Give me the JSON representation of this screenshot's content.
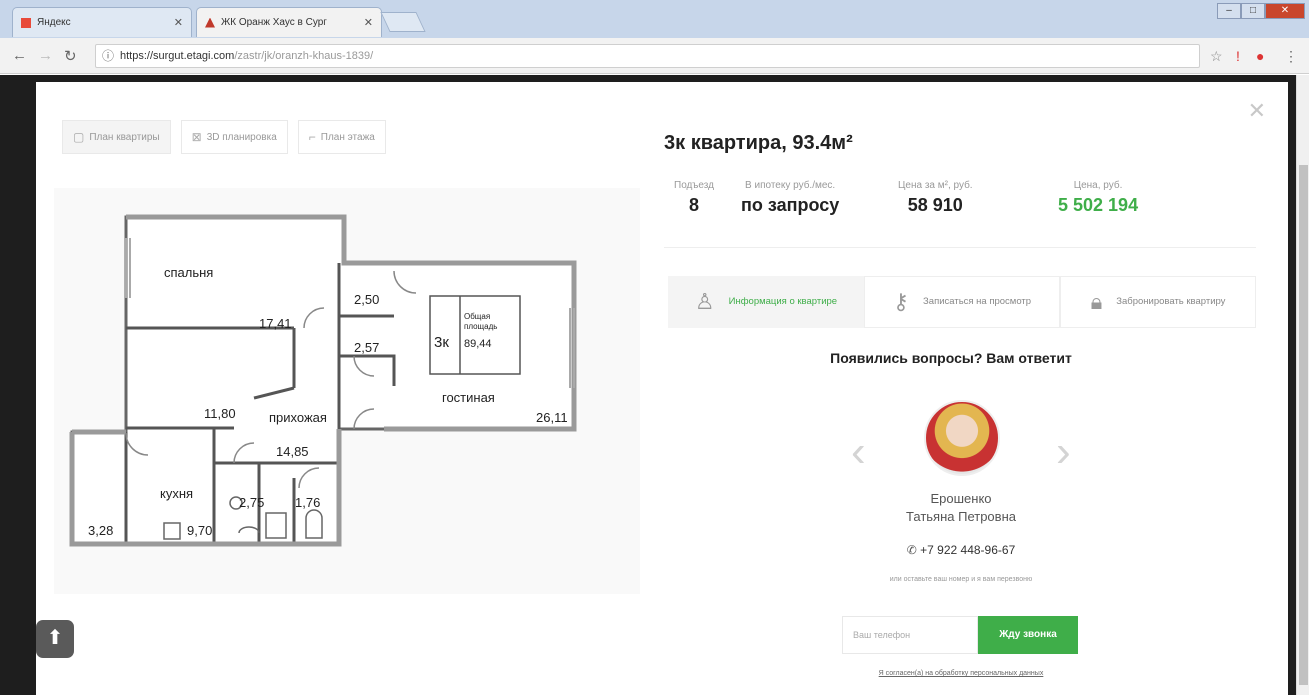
{
  "browser": {
    "tabs": [
      {
        "label": "Яндекс",
        "active": false
      },
      {
        "label": "ЖК Оранж Хаус в Сург",
        "active": true
      }
    ],
    "url_host": "https://surgut.etagi.com",
    "url_path": "/zastr/jk/oranzh-khaus-1839/"
  },
  "modal": {
    "plan_tabs": [
      {
        "label": "План квартиры",
        "icon": "floorplan-icon"
      },
      {
        "label": "3D планировка",
        "icon": "3d-icon"
      },
      {
        "label": "План этажа",
        "icon": "floor-icon"
      }
    ],
    "floorplan": {
      "rooms": [
        {
          "name": "спальня",
          "area": "17,41"
        },
        {
          "name": "",
          "area": "11,80"
        },
        {
          "name": "прихожая",
          "area": "14,85"
        },
        {
          "name": "гостиная",
          "area": "26,11"
        },
        {
          "name": "кухня",
          "area": "9,70"
        },
        {
          "name": "",
          "area": "2,50"
        },
        {
          "name": "",
          "area": "2,57"
        },
        {
          "name": "",
          "area": "2,75"
        },
        {
          "name": "",
          "area": "1,76"
        },
        {
          "name": "",
          "area": "3,28"
        }
      ],
      "badge_type": "3к",
      "badge_area_label": "Общая площадь",
      "badge_area": "89,44"
    },
    "title": "3к квартира, 93.4м²",
    "stats": [
      {
        "label": "Подъезд",
        "value": "8"
      },
      {
        "label": "В ипотеку руб./мес.",
        "value": "по запросу"
      },
      {
        "label": "Цена за м², руб.",
        "value": "58 910"
      },
      {
        "label": "Цена, руб.",
        "value": "5 502 194"
      }
    ],
    "info_tabs": [
      {
        "label": "Информация о квартире",
        "icon": "user-icon"
      },
      {
        "label": "Записаться на просмотр",
        "icon": "keys-icon"
      },
      {
        "label": "Забронировать квартиру",
        "icon": "lock-icon"
      }
    ],
    "question": "Появились вопросы? Вам ответит",
    "agent_name_1": "Ерошенко",
    "agent_name_2": "Татьяна Петровна",
    "phone": "+7 922 448-96-67",
    "note": "или оставьте ваш номер и я вам перезвоню",
    "phone_placeholder": "Ваш телефон",
    "call_button": "Жду звонка",
    "agree_text": "Я согласен(а) на обработку персональных данных"
  },
  "colors": {
    "accent_green": "#3fae49",
    "backdrop": "#1e1e1e"
  }
}
